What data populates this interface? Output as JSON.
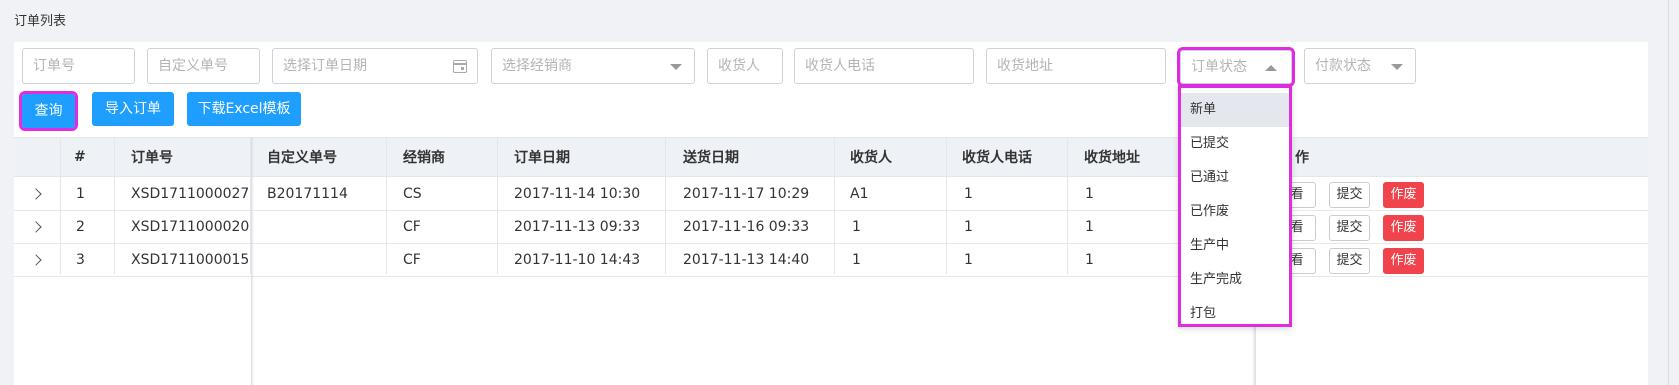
{
  "page_title": "订单列表",
  "filters": {
    "order_no": "订单号",
    "custom_order_no": "自定义单号",
    "order_date": "选择订单日期",
    "dealer": "选择经销商",
    "receiver": "收货人",
    "receiver_phone": "收货人电话",
    "receiver_address": "收货地址",
    "order_status": "订单状态",
    "payment_status": "付款状态"
  },
  "buttons": {
    "query": "查询",
    "import_orders": "导入订单",
    "download_template": "下载Excel模板"
  },
  "table": {
    "headers": {
      "index": "#",
      "order_no": "订单号",
      "custom_no": "自定义单号",
      "dealer": "经销商",
      "order_date": "订单日期",
      "delivery_date": "送货日期",
      "receiver": "收货人",
      "receiver_phone": "收货人电话",
      "receiver_address": "收货地址",
      "actions": "作"
    },
    "rows": [
      {
        "index": "1",
        "order_no": "XSD1711000027",
        "custom_no": "B20171114",
        "dealer": "CS",
        "order_date": "2017-11-14 10:30",
        "delivery_date": "2017-11-17 10:29",
        "receiver": "A1",
        "receiver_phone": "1",
        "receiver_address": "1"
      },
      {
        "index": "2",
        "order_no": "XSD1711000020",
        "custom_no": "",
        "dealer": "CF",
        "order_date": "2017-11-13 09:33",
        "delivery_date": "2017-11-16 09:33",
        "receiver": "1",
        "receiver_phone": "1",
        "receiver_address": "1"
      },
      {
        "index": "3",
        "order_no": "XSD1711000015",
        "custom_no": "",
        "dealer": "CF",
        "order_date": "2017-11-10 14:43",
        "delivery_date": "2017-11-13 14:40",
        "receiver": "1",
        "receiver_phone": "1",
        "receiver_address": "1"
      }
    ],
    "actions": {
      "view": "看",
      "submit": "提交",
      "void": "作废"
    }
  },
  "status_dropdown": {
    "options": [
      "新单",
      "已提交",
      "已通过",
      "已作废",
      "生产中",
      "生产完成",
      "打包"
    ],
    "active_index": 0
  },
  "colors": {
    "primary": "#1e9fff",
    "danger": "#f0434b",
    "highlight": "#e02ce0",
    "header_bg": "#eef1f6"
  }
}
